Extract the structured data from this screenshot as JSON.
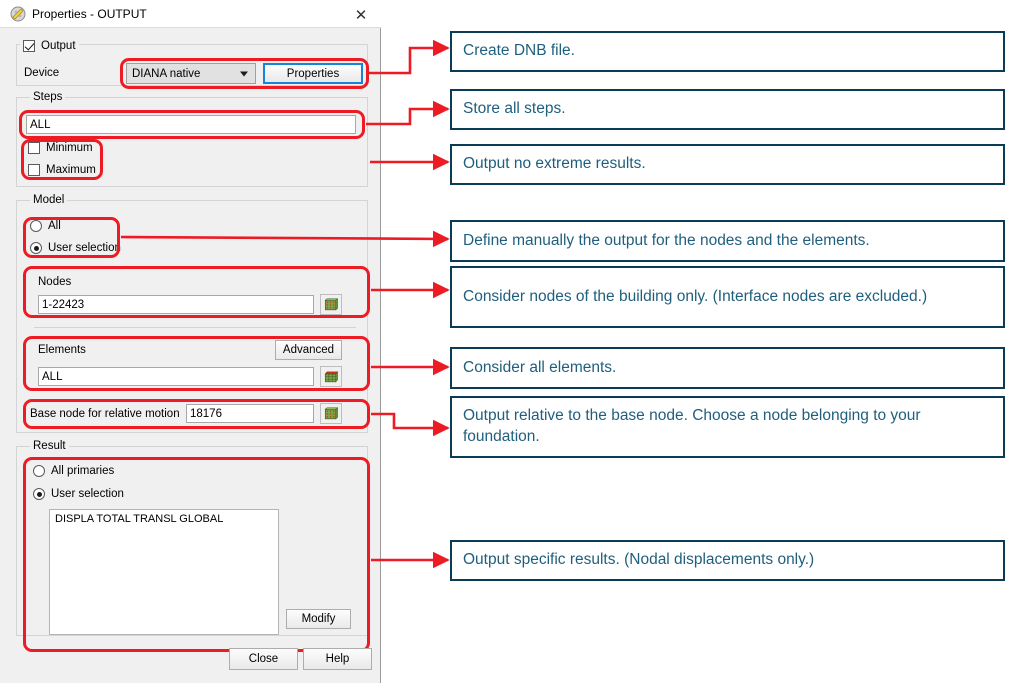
{
  "window": {
    "title": "Properties - OUTPUT",
    "app_icon": "diana-properties-icon",
    "close_label": "✕"
  },
  "dialog": {
    "output_group": {
      "checkbox_label": "Output",
      "checked": true,
      "device_label": "Device",
      "device_value": "DIANA native",
      "properties_button": "Properties"
    },
    "steps_group": {
      "legend": "Steps",
      "steps_value": "ALL",
      "minimum_label": "Minimum",
      "minimum_checked": false,
      "maximum_label": "Maximum",
      "maximum_checked": false
    },
    "model_group": {
      "legend": "Model",
      "all_label": "All",
      "user_selection_label": "User selection",
      "selected": "User selection",
      "nodes_label": "Nodes",
      "nodes_value": "1-22423",
      "elements_label": "Elements",
      "elements_advanced_button": "Advanced",
      "elements_value": "ALL",
      "base_node_label": "Base node for relative motion",
      "base_node_value": "18176",
      "node_picker_icon": "mesh-node-picker-icon",
      "element_picker_icon": "mesh-element-picker-icon"
    },
    "result_group": {
      "legend": "Result",
      "all_primaries_label": "All primaries",
      "user_selection_label": "User selection",
      "selected": "User selection",
      "result_items": [
        "DISPLA TOTAL TRANSL GLOBAL"
      ],
      "modify_button": "Modify"
    },
    "footer": {
      "close_button": "Close",
      "help_button": "Help"
    }
  },
  "annotations": [
    {
      "id": "note-create-dnb",
      "text": "Create DNB file."
    },
    {
      "id": "note-store-steps",
      "text": "Store all steps."
    },
    {
      "id": "note-no-extremes",
      "text": "Output no extreme results."
    },
    {
      "id": "note-define-manually",
      "text": "Define manually the output for the nodes and the elements."
    },
    {
      "id": "note-building-nodes",
      "text": "Consider nodes of the building only. (Interface nodes are excluded.)"
    },
    {
      "id": "note-all-elements",
      "text": "Consider all elements."
    },
    {
      "id": "note-base-node",
      "text": "Output relative to the base node. Choose a node belonging to your foundation."
    },
    {
      "id": "note-specific-results",
      "text": "Output specific results. (Nodal displacements only.)"
    }
  ],
  "colors": {
    "highlight_red": "#ed1c24",
    "note_border": "#0a3d55",
    "note_text": "#1f5f7d",
    "focus_blue": "#1884d8"
  }
}
